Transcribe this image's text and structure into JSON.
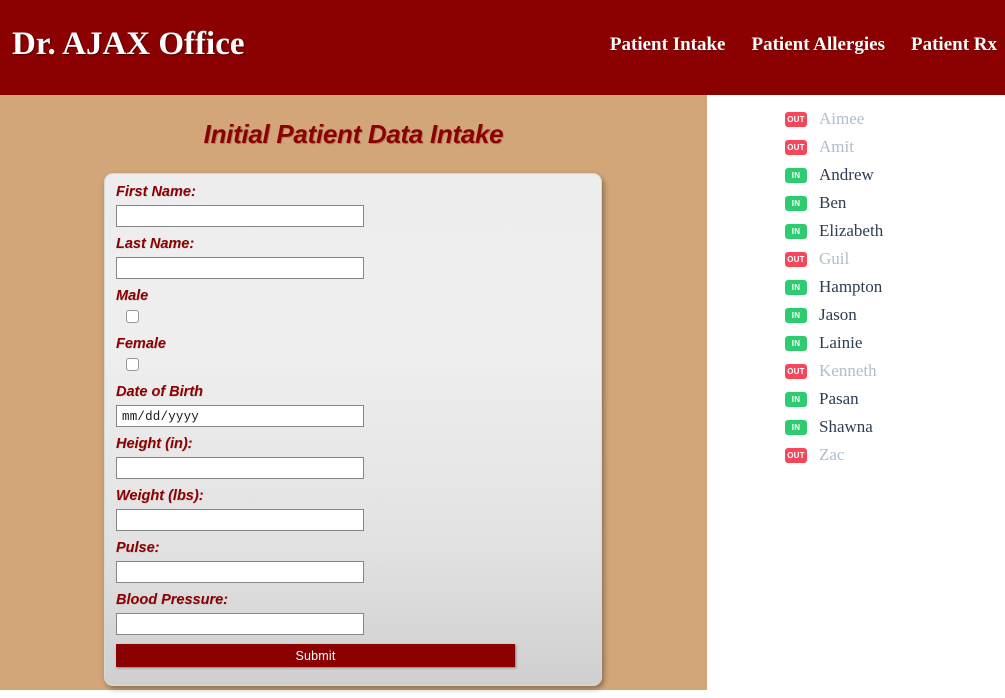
{
  "header": {
    "brand": "Dr. AJAX Office",
    "nav": [
      {
        "label": "Patient Intake"
      },
      {
        "label": "Patient Allergies"
      },
      {
        "label": "Patient Rx"
      }
    ],
    "background_color": "#8b0000"
  },
  "main": {
    "background_color": "#d2a679",
    "page_title": "Initial Patient Data Intake",
    "form": {
      "fields": [
        {
          "label": "First Name:",
          "value": "",
          "type": "text"
        },
        {
          "label": "Last Name:",
          "value": "",
          "type": "text"
        },
        {
          "label": "Male",
          "value": "",
          "type": "checkbox",
          "checked": false
        },
        {
          "label": "Female",
          "value": "",
          "type": "checkbox",
          "checked": false
        },
        {
          "label": "Date of Birth",
          "value": "",
          "placeholder": "mm/dd/yyyy",
          "type": "date"
        },
        {
          "label": "Height (in):",
          "value": "",
          "type": "text"
        },
        {
          "label": "Weight (lbs):",
          "value": "",
          "type": "text"
        },
        {
          "label": "Pulse:",
          "value": "",
          "type": "text"
        },
        {
          "label": "Blood Pressure:",
          "value": "",
          "type": "text"
        }
      ],
      "submit_label": "Submit",
      "label_color": "#8b0000",
      "submit_color": "#8b0000"
    }
  },
  "sidebar": {
    "background_color": "#ffffff",
    "status_in_label": "IN",
    "status_out_label": "OUT",
    "status_in_color": "#2ecc71",
    "status_out_color": "#f4475c",
    "patients": [
      {
        "name": "Aimee",
        "status": "OUT"
      },
      {
        "name": "Amit",
        "status": "OUT"
      },
      {
        "name": "Andrew",
        "status": "IN"
      },
      {
        "name": "Ben",
        "status": "IN"
      },
      {
        "name": "Elizabeth",
        "status": "IN"
      },
      {
        "name": "Guil",
        "status": "OUT"
      },
      {
        "name": "Hampton",
        "status": "IN"
      },
      {
        "name": "Jason",
        "status": "IN"
      },
      {
        "name": "Lainie",
        "status": "IN"
      },
      {
        "name": "Kenneth",
        "status": "OUT"
      },
      {
        "name": "Pasan",
        "status": "IN"
      },
      {
        "name": "Shawna",
        "status": "IN"
      },
      {
        "name": "Zac",
        "status": "OUT"
      }
    ]
  }
}
